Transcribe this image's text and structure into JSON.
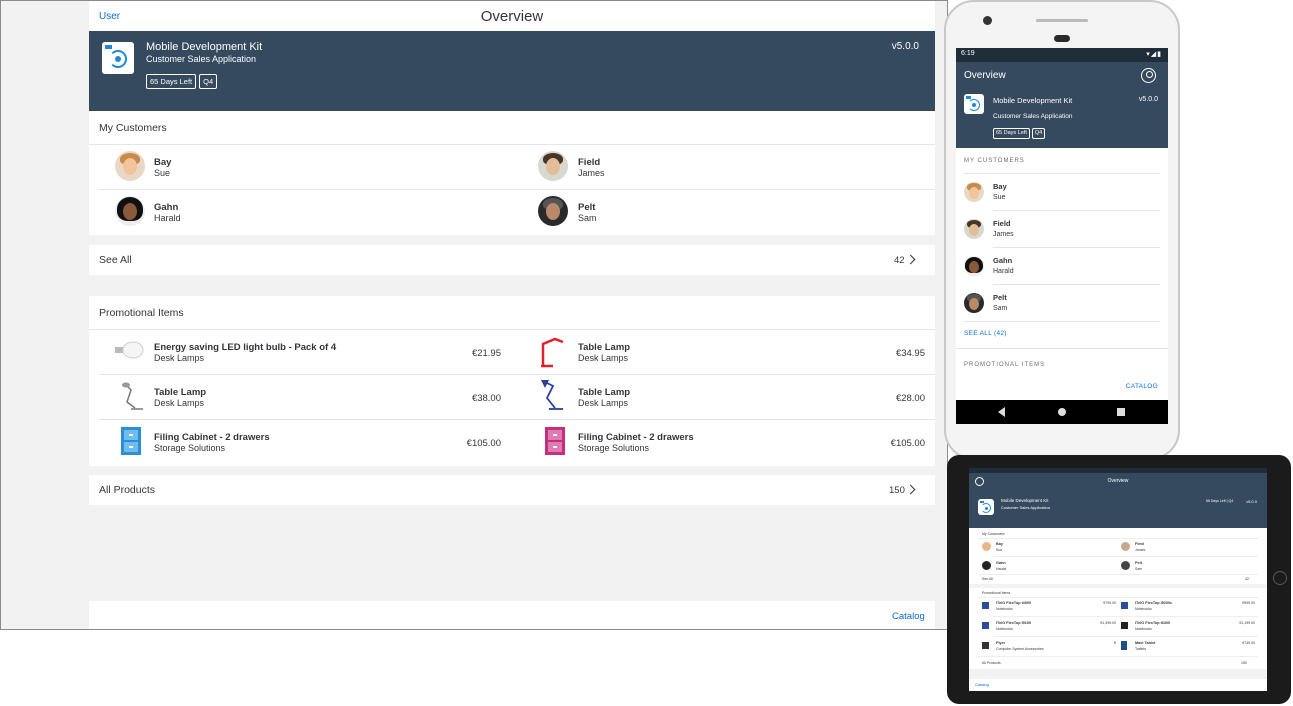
{
  "desktop": {
    "user_link": "User",
    "title": "Overview",
    "header": {
      "app_name": "Mobile Development Kit",
      "app_subtitle": "Customer Sales Application",
      "version": "v5.0.0",
      "badges": [
        "65 Days Left",
        "Q4"
      ]
    },
    "customers": {
      "title": "My Customers",
      "items": [
        {
          "last": "Bay",
          "first": "Sue"
        },
        {
          "last": "Field",
          "first": "James"
        },
        {
          "last": "Gahn",
          "first": "Harald"
        },
        {
          "last": "Pelt",
          "first": "Sam"
        }
      ],
      "see_all_label": "See All",
      "see_all_count": "42"
    },
    "promotions": {
      "title": "Promotional Items",
      "items": [
        {
          "name": "Energy saving LED light bulb - Pack of 4",
          "category": "Desk Lamps",
          "price": "€21.95"
        },
        {
          "name": "Table Lamp",
          "category": "Desk Lamps",
          "price": "€34.95"
        },
        {
          "name": "Table Lamp",
          "category": "Desk Lamps",
          "price": "€38.00"
        },
        {
          "name": "Table Lamp",
          "category": "Desk Lamps",
          "price": "€28.00"
        },
        {
          "name": "Filing Cabinet - 2 drawers",
          "category": "Storage Solutions",
          "price": "€105.00"
        },
        {
          "name": "Filing Cabinet - 2 drawers",
          "category": "Storage Solutions",
          "price": "€105.00"
        }
      ],
      "all_products_label": "All Products",
      "all_products_count": "150"
    },
    "catalog_link": "Catalog"
  },
  "phone": {
    "time": "6:19",
    "title": "Overview",
    "header": {
      "app_name": "Mobile Development Kit",
      "app_subtitle": "Customer Sales Application",
      "version": "v5.0.0",
      "badges": [
        "65 Days Left",
        "Q4"
      ]
    },
    "customers_caption": "MY CUSTOMERS",
    "customers": [
      {
        "last": "Bay",
        "first": "Sue"
      },
      {
        "last": "Field",
        "first": "James"
      },
      {
        "last": "Gahn",
        "first": "Harald"
      },
      {
        "last": "Pelt",
        "first": "Sam"
      }
    ],
    "see_all": "SEE ALL (42)",
    "promotions_caption": "PROMOTIONAL ITEMS",
    "catalog": "CATALOG"
  },
  "tablet": {
    "title": "Overview",
    "header": {
      "app_name": "Mobile Development Kit",
      "app_subtitle": "Customer Sales Application",
      "badges": "65 Days Left | Q4",
      "version": "v5.0.0"
    },
    "customers_caption": "My Customers",
    "customers": [
      {
        "last": "Bay",
        "first": "Sue"
      },
      {
        "last": "Field",
        "first": "James"
      },
      {
        "last": "Gahn",
        "first": "Harald"
      },
      {
        "last": "Pelt",
        "first": "Sam"
      }
    ],
    "see_all": "See All",
    "see_all_count": "42",
    "promotions_caption": "Promotional Items",
    "products": [
      {
        "name": "ITelO FlexTop I4000",
        "category": "Notebooks",
        "price": "€799.00"
      },
      {
        "name": "ITelO FlexTop I9200c",
        "category": "Notebooks",
        "price": "€999.00"
      },
      {
        "name": "ITelO FlexTop I9100",
        "category": "Notebooks",
        "price": "€1,399.00"
      },
      {
        "name": "ITelO FlexTop I6300",
        "category": "Notebooks",
        "price": "€1,199.00"
      },
      {
        "name": "Flyer",
        "category": "Computer System Accessories",
        "price": "€"
      },
      {
        "name": "Maxi Tablet",
        "category": "Tablets",
        "price": "€749.00"
      }
    ],
    "all_products": "All Products",
    "all_products_count": "150",
    "catalog": "Catalog"
  },
  "colors": {
    "shell": "#354a5f",
    "link": "#0a6ed1",
    "text": "#32363a",
    "background": "#f2f2f2"
  }
}
